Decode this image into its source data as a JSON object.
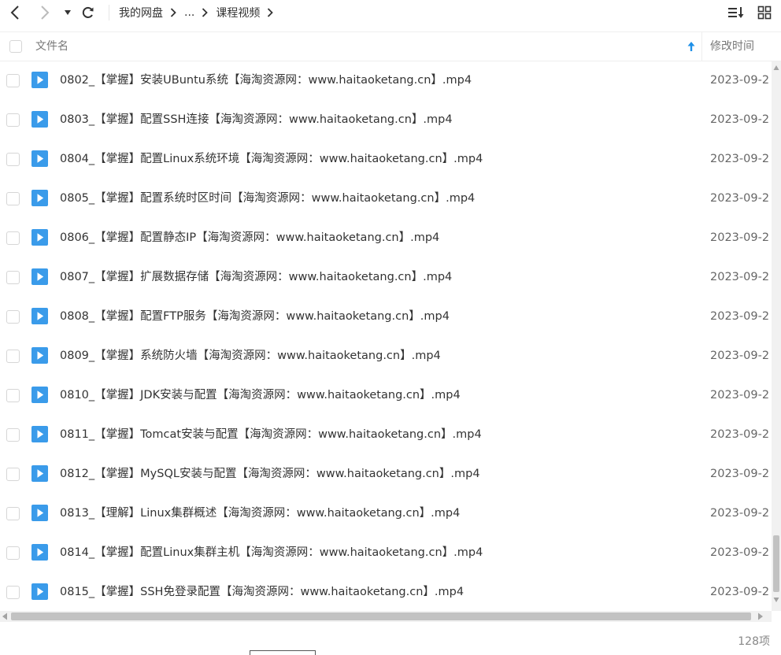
{
  "toolbar": {
    "breadcrumb": [
      "我的网盘",
      "...",
      "课程视频"
    ]
  },
  "header": {
    "name_label": "文件名",
    "date_label": "修改时间"
  },
  "files": [
    {
      "name": "0802_【掌握】安装UBuntu系统【海淘资源网：www.haitaoketang.cn】.mp4",
      "date": "2023-09-2"
    },
    {
      "name": "0803_【掌握】配置SSH连接【海淘资源网：www.haitaoketang.cn】.mp4",
      "date": "2023-09-2"
    },
    {
      "name": "0804_【掌握】配置Linux系统环境【海淘资源网：www.haitaoketang.cn】.mp4",
      "date": "2023-09-2"
    },
    {
      "name": "0805_【掌握】配置系统时区时间【海淘资源网：www.haitaoketang.cn】.mp4",
      "date": "2023-09-2"
    },
    {
      "name": "0806_【掌握】配置静态IP【海淘资源网：www.haitaoketang.cn】.mp4",
      "date": "2023-09-2"
    },
    {
      "name": "0807_【掌握】扩展数据存储【海淘资源网：www.haitaoketang.cn】.mp4",
      "date": "2023-09-2"
    },
    {
      "name": "0808_【掌握】配置FTP服务【海淘资源网：www.haitaoketang.cn】.mp4",
      "date": "2023-09-2"
    },
    {
      "name": "0809_【掌握】系统防火墙【海淘资源网：www.haitaoketang.cn】.mp4",
      "date": "2023-09-2"
    },
    {
      "name": "0810_【掌握】JDK安装与配置【海淘资源网：www.haitaoketang.cn】.mp4",
      "date": "2023-09-2"
    },
    {
      "name": "0811_【掌握】Tomcat安装与配置【海淘资源网：www.haitaoketang.cn】.mp4",
      "date": "2023-09-2"
    },
    {
      "name": "0812_【掌握】MySQL安装与配置【海淘资源网：www.haitaoketang.cn】.mp4",
      "date": "2023-09-2"
    },
    {
      "name": "0813_【理解】Linux集群概述【海淘资源网：www.haitaoketang.cn】.mp4",
      "date": "2023-09-2"
    },
    {
      "name": "0814_【掌握】配置Linux集群主机【海淘资源网：www.haitaoketang.cn】.mp4",
      "date": "2023-09-2"
    },
    {
      "name": "0815_【掌握】SSH免登录配置【海淘资源网：www.haitaoketang.cn】.mp4",
      "date": "2023-09-2"
    }
  ],
  "footer": {
    "count": "128项"
  },
  "colors": {
    "video_icon": "#3a9bea",
    "sort_arrow": "#1e90e8"
  },
  "icons": {
    "file": "video-file-icon"
  }
}
